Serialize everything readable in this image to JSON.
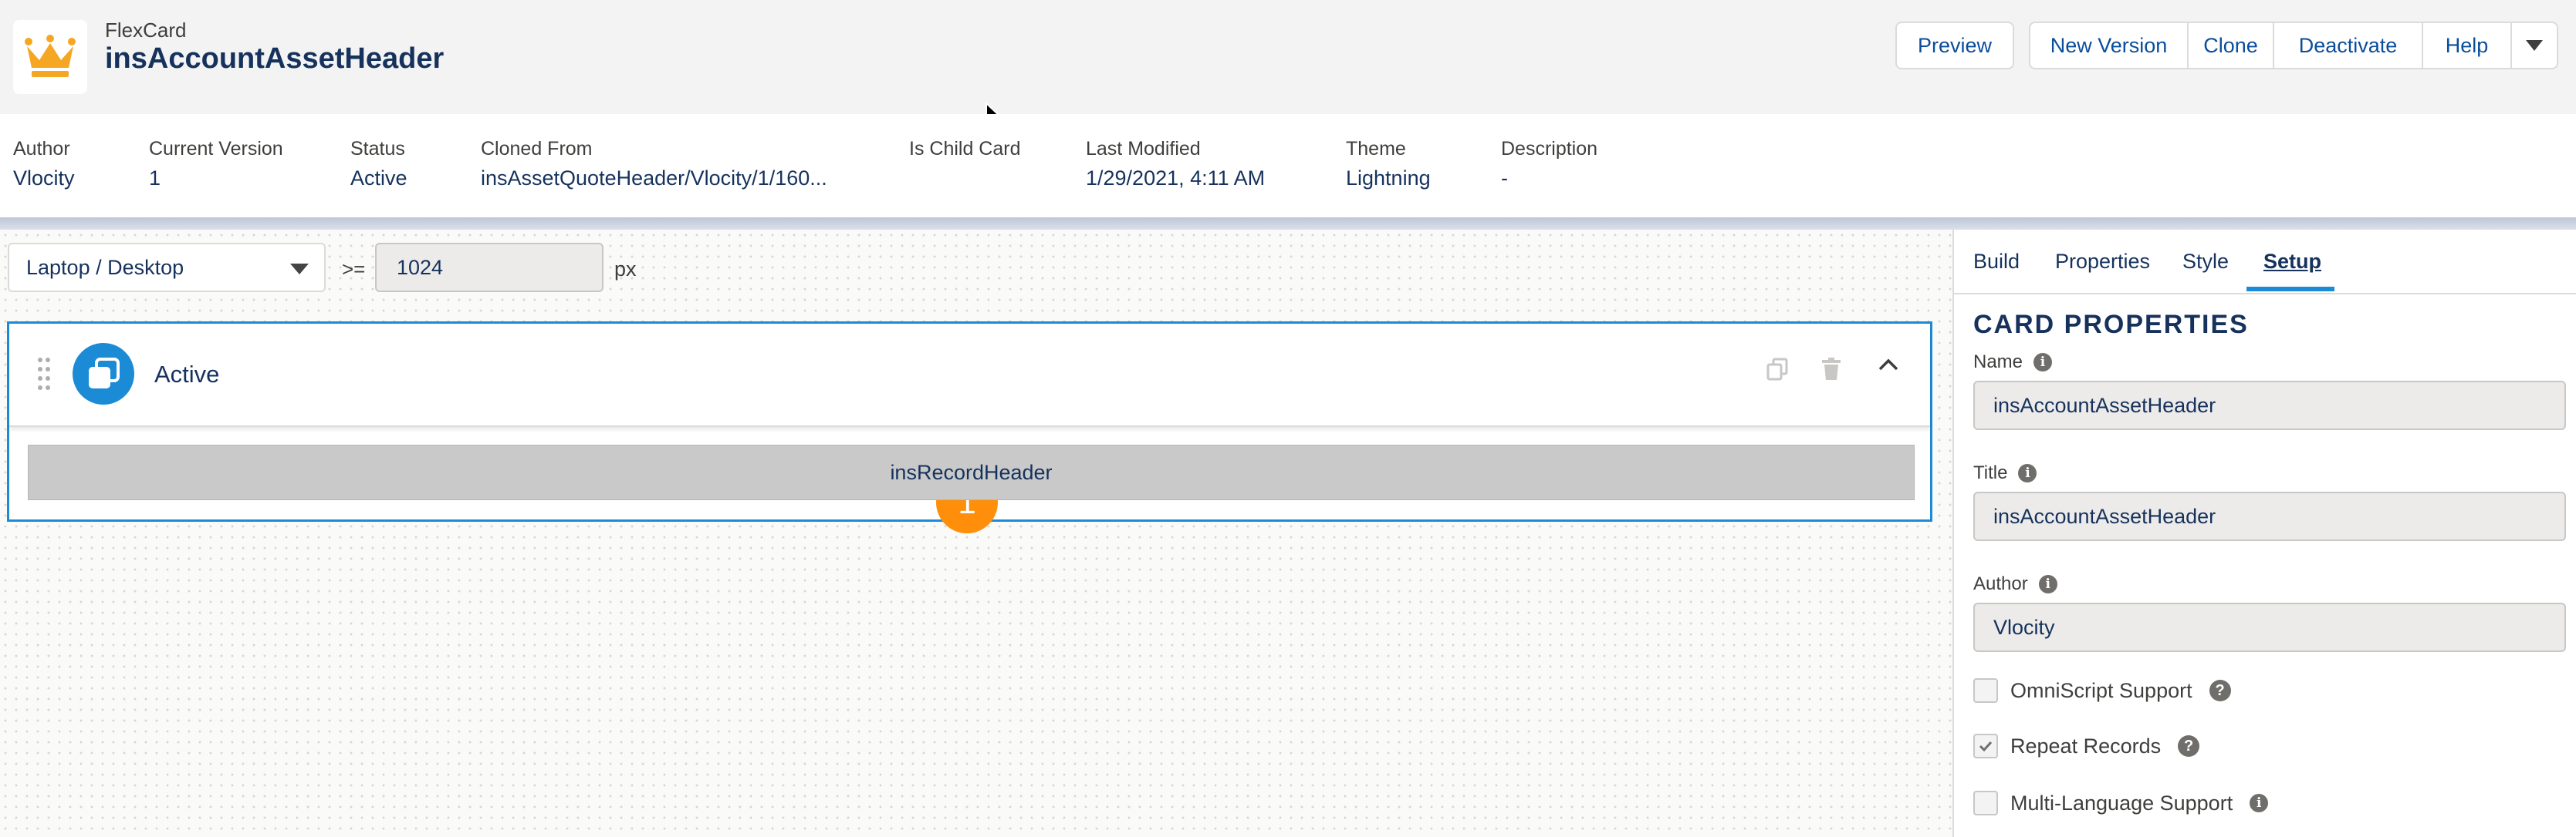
{
  "header": {
    "object_type": "FlexCard",
    "title": "insAccountAssetHeader",
    "logo_icon": "crown-icon",
    "buttons": {
      "preview": "Preview",
      "new_version": "New Version",
      "clone": "Clone",
      "deactivate": "Deactivate",
      "help": "Help"
    }
  },
  "info": [
    {
      "label": "Author",
      "value": "Vlocity"
    },
    {
      "label": "Current Version",
      "value": "1"
    },
    {
      "label": "Status",
      "value": "Active"
    },
    {
      "label": "Cloned From",
      "value": "insAssetQuoteHeader/Vlocity/1/160..."
    },
    {
      "label": "Is Child Card",
      "value": ""
    },
    {
      "label": "Last Modified",
      "value": "1/29/2021, 4:11 AM"
    },
    {
      "label": "Theme",
      "value": "Lightning"
    },
    {
      "label": "Description",
      "value": "-"
    }
  ],
  "canvas": {
    "device": "Laptop / Desktop",
    "operator": ">=",
    "min_width": "1024",
    "unit": "px",
    "state": {
      "name": "Active",
      "step_badge": "1",
      "child_element": "insRecordHeader"
    }
  },
  "panel": {
    "tabs": [
      "Build",
      "Properties",
      "Style",
      "Setup"
    ],
    "active_tab": "Setup",
    "section_title": "CARD PROPERTIES",
    "name_label": "Name",
    "name_value": "insAccountAssetHeader",
    "title_label": "Title",
    "title_value": "insAccountAssetHeader",
    "author_label": "Author",
    "author_value": "Vlocity",
    "options": [
      {
        "label": "OmniScript Support",
        "checked": false,
        "hint": "help"
      },
      {
        "label": "Repeat Records",
        "checked": true,
        "hint": "help"
      },
      {
        "label": "Multi-Language Support",
        "checked": false,
        "hint": "info"
      }
    ]
  },
  "colors": {
    "accent": "#1b8bd6",
    "badge": "#ff8e0a",
    "logo": "#f5a623",
    "link": "#0a4e9b"
  }
}
